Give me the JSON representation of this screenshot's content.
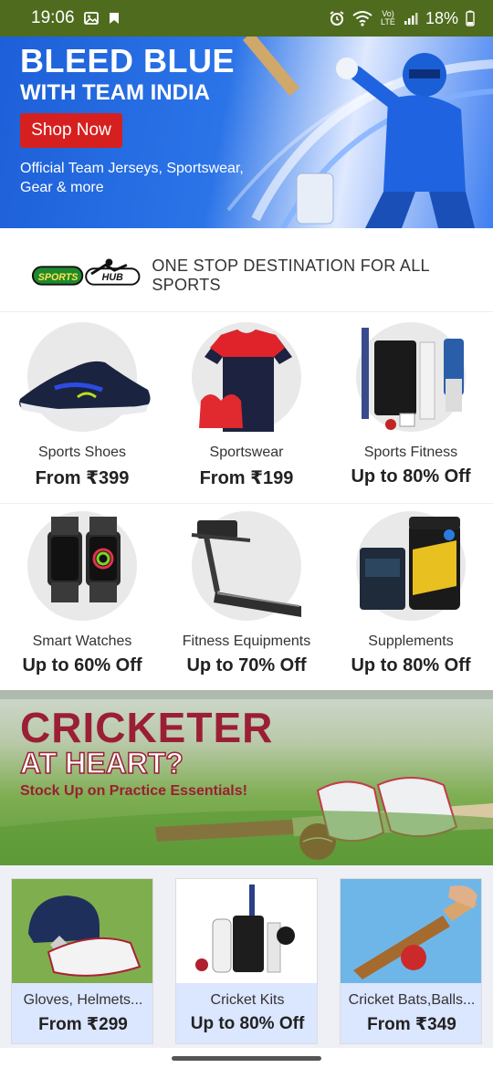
{
  "status_bar": {
    "time": "19:06",
    "lte_label": "Vo) LTE",
    "battery": "18%"
  },
  "hero": {
    "title_line1": "BLEED BLUE",
    "title_line2": "WITH TEAM INDIA",
    "cta": "Shop Now",
    "subtitle": "Official Team Jerseys, Sportswear, Gear & more",
    "colors": {
      "accent": "#d6201f",
      "brand_blue": "#1d5fd8"
    }
  },
  "hub": {
    "logo_text": "SPORTS HUB",
    "tagline": "ONE STOP DESTINATION FOR ALL SPORTS"
  },
  "categories": [
    {
      "name": "Sports Shoes",
      "offer": "From ₹399",
      "icon": "sneaker-image"
    },
    {
      "name": "Sportswear",
      "offer": "From ₹199",
      "icon": "tshirt-image"
    },
    {
      "name": "Sports Fitness",
      "offer": "Up to 80% Off",
      "icon": "cricket-gear-image"
    },
    {
      "name": "Smart Watches",
      "offer": "Up to 60% Off",
      "icon": "smartwatch-image"
    },
    {
      "name": "Fitness Equipments",
      "offer": "Up to 70% Off",
      "icon": "treadmill-image"
    },
    {
      "name": "Supplements",
      "offer": "Up to 80% Off",
      "icon": "supplement-tub-image"
    }
  ],
  "cricket_banner": {
    "title_line1": "CRICKETER",
    "title_line2": "AT HEART?",
    "subtitle": "Stock Up on Practice Essentials!",
    "accent": "#9a1f34"
  },
  "cards": [
    {
      "label": "Gloves, Helmets...",
      "offer": "From ₹299"
    },
    {
      "label": "Cricket Kits",
      "offer": "Up to 80% Off"
    },
    {
      "label": "Cricket Bats,Balls...",
      "offer": "From ₹349"
    }
  ]
}
